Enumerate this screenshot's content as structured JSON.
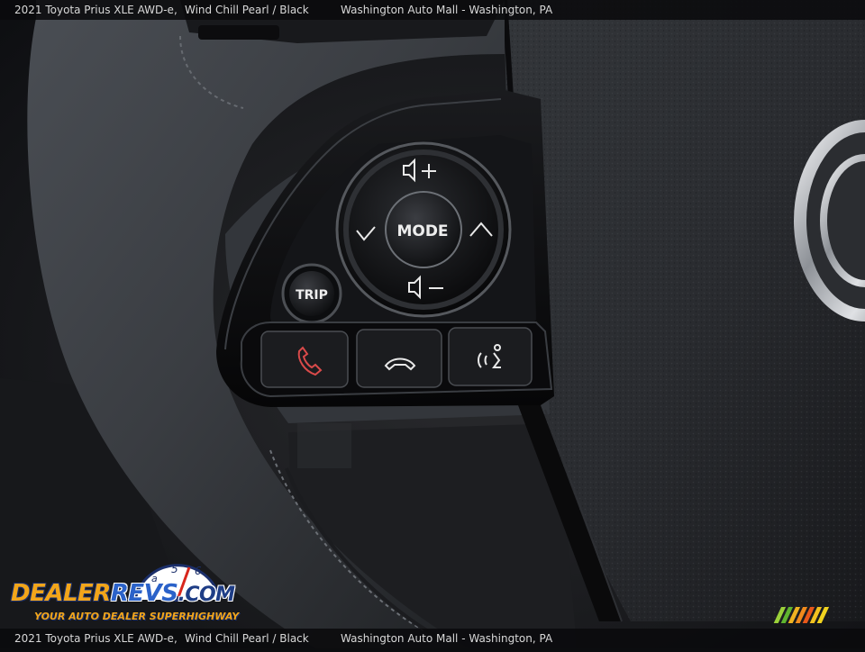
{
  "caption": {
    "vehicle": "2021 Toyota Prius XLE AWD-e,",
    "color": "Wind Chill Pearl / Black",
    "dealer": "Washington Auto Mall - Washington, PA"
  },
  "controls": {
    "mode_label": "MODE",
    "trip_label": "TRIP"
  },
  "icons": {
    "volume_up": "volume-up-icon",
    "volume_down": "volume-down-icon",
    "prev": "chevron-left-icon",
    "next": "chevron-right-icon",
    "call": "phone-call-icon",
    "hangup": "phone-hangup-icon",
    "voice": "voice-command-icon"
  },
  "watermark": {
    "brand_dealer": "DEALER",
    "brand_revs": "REVS",
    "brand_domain": ".COM",
    "tagline": "YOUR AUTO DEALER SUPERHIGHWAY",
    "gauge_digits": "a 5 6"
  },
  "colors": {
    "leather": "#2f3236",
    "button_black": "#111214",
    "trim_chrome": "#b9bcc0",
    "brand_orange": "#f2a51a",
    "brand_blue": "#2b62c9"
  }
}
